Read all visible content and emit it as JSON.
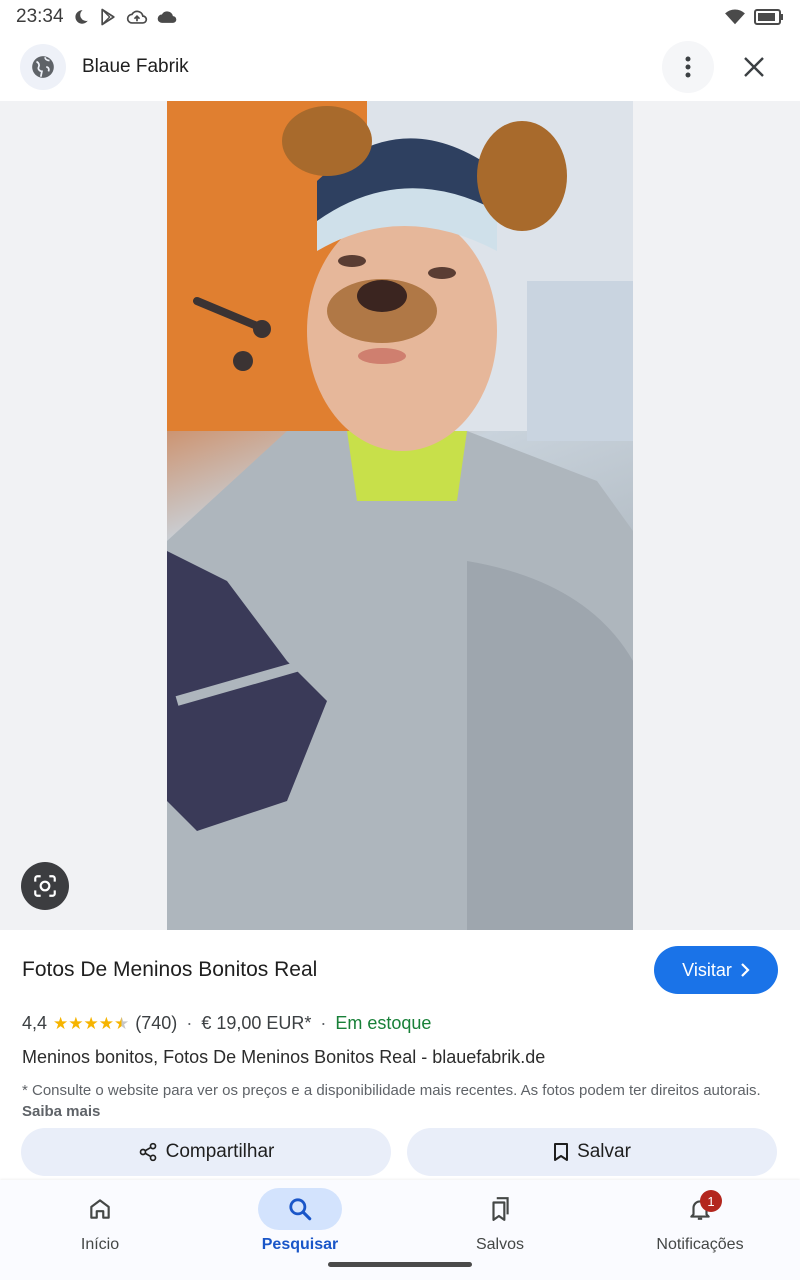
{
  "status_bar": {
    "time": "23:34",
    "left_icons": [
      "moon-icon",
      "play-store-icon",
      "cloud-upload-icon",
      "cloud-icon"
    ],
    "right_icons": [
      "wifi-icon",
      "battery-icon"
    ]
  },
  "header": {
    "site_icon": "globe-icon",
    "site_name": "Blaue Fabrik",
    "more_icon": "more-vert-icon",
    "close_icon": "close-icon"
  },
  "image": {
    "lens_icon": "google-lens-icon"
  },
  "result": {
    "title": "Fotos De Meninos Bonitos Real",
    "visit_label": "Visitar",
    "rating": "4,4",
    "rating_value": 4.4,
    "rating_max": 5,
    "review_count": "(740)",
    "price": "€ 19,00 EUR*",
    "availability": "Em estoque",
    "description": "Meninos bonitos, Fotos De Meninos Bonitos Real - blauefabrik.de",
    "disclaimer": "* Consulte o website para ver os preços e a disponibilidade mais recentes. As fotos podem ter direitos autorais.",
    "learn_more": "Saiba mais"
  },
  "actions": {
    "share_label": "Compartilhar",
    "save_label": "Salvar"
  },
  "bottom_nav": {
    "items": [
      {
        "label": "Início",
        "icon": "home-icon"
      },
      {
        "label": "Pesquisar",
        "icon": "search-icon",
        "active": true
      },
      {
        "label": "Salvos",
        "icon": "bookmarks-icon"
      },
      {
        "label": "Notificações",
        "icon": "bell-icon",
        "badge": "1"
      }
    ]
  },
  "colors": {
    "accent": "#1a73e8",
    "stock_green": "#188038",
    "star": "#f6b400",
    "badge": "#b3261e"
  }
}
